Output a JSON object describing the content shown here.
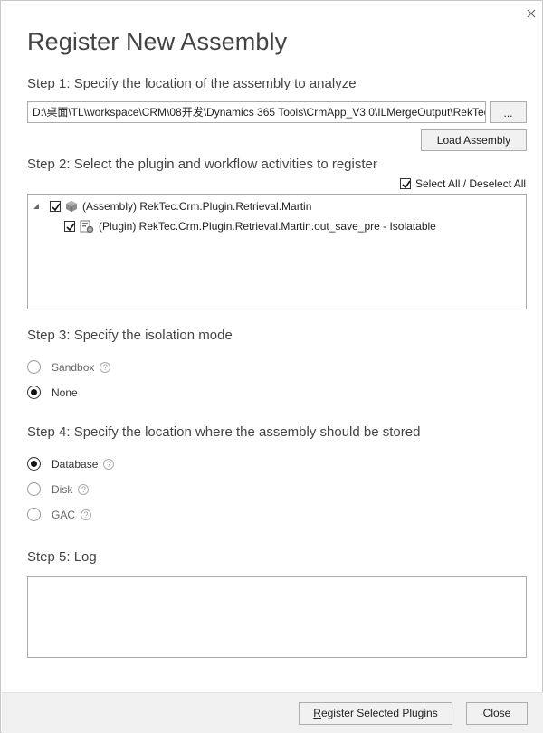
{
  "dialog": {
    "title": "Register New Assembly"
  },
  "step1": {
    "label": "Step 1: Specify the location of the assembly to analyze",
    "path_value": "D:\\桌面\\TL\\workspace\\CRM\\08开发\\Dynamics 365 Tools\\CrmApp_V3.0\\ILMergeOutput\\RekTec.Crm.Plugin.Retrieval.Martin.dll",
    "browse_label": "...",
    "load_label": "Load Assembly"
  },
  "step2": {
    "label": "Step 2: Select the plugin and workflow activities to register",
    "select_all_label": "Select All / Deselect All",
    "select_all_checked": true,
    "tree": {
      "assembly": {
        "label": "(Assembly) RekTec.Crm.Plugin.Retrieval.Martin",
        "checked": true,
        "expanded": true
      },
      "plugins": [
        {
          "label": "(Plugin) RekTec.Crm.Plugin.Retrieval.Martin.out_save_pre - Isolatable",
          "checked": true
        }
      ]
    }
  },
  "step3": {
    "label": "Step 3: Specify the isolation mode",
    "options": [
      {
        "label": "Sandbox",
        "checked": false,
        "help": true
      },
      {
        "label": "None",
        "checked": true,
        "help": false
      }
    ]
  },
  "step4": {
    "label": "Step 4: Specify the location where the assembly should be stored",
    "options": [
      {
        "label": "Database",
        "checked": true
      },
      {
        "label": "Disk",
        "checked": false
      },
      {
        "label": "GAC",
        "checked": false
      }
    ]
  },
  "step5": {
    "label": "Step 5: Log",
    "log_text": ""
  },
  "footer": {
    "register_label": "Register Selected Plugins",
    "close_label": "Close"
  },
  "icons": {
    "close": "close-icon",
    "help": "help-icon",
    "assembly": "assembly-icon",
    "plugin": "plugin-icon"
  },
  "help_glyph": "?"
}
